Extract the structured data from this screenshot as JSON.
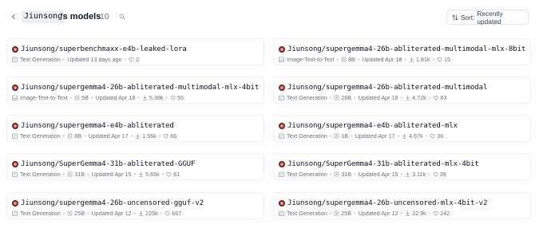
{
  "header": {
    "back_icon": "chevron-left-icon",
    "username": "Jiunsong",
    "title_suffix": "'s models",
    "count": "10",
    "search_icon": "search-icon",
    "sort_label": "Sort:",
    "sort_value": "Recently updated",
    "sort_icon": "sort-arrows-icon"
  },
  "models": [
    {
      "name": "Jiunsong/superbenchmaxx-e4b-leaked-lora",
      "task": "Text Generation",
      "task_icon": "text-generation-icon",
      "params": "",
      "updated": "Updated 13 days ago",
      "downloads": "",
      "likes": "2"
    },
    {
      "name": "Jiunsong/supergemma4-26b-abliterated-multimodal-mlx-8bit",
      "task": "Image-Text-to-Text",
      "task_icon": "image-text-to-text-icon",
      "params": "8B",
      "updated": "Updated Apr 18",
      "downloads": "1.81k",
      "likes": "15"
    },
    {
      "name": "Jiunsong/supergemma4-26b-abliterated-multimodal-mlx-4bit",
      "task": "Image-Text-to-Text",
      "task_icon": "image-text-to-text-icon",
      "params": "5B",
      "updated": "Updated Apr 18",
      "downloads": "5.38k",
      "likes": "55"
    },
    {
      "name": "Jiunsong/supergemma4-26b-abliterated-multimodal",
      "task": "Text Generation",
      "task_icon": "text-generation-icon",
      "params": "26B",
      "updated": "Updated Apr 18",
      "downloads": "4.72k",
      "likes": "83"
    },
    {
      "name": "Jiunsong/supergemma4-e4b-abliterated",
      "task": "Text Generation",
      "task_icon": "text-generation-icon",
      "params": "8B",
      "updated": "Updated Apr 17",
      "downloads": "1.56k",
      "likes": "66"
    },
    {
      "name": "Jiunsong/supergemma4-e4b-abliterated-mlx",
      "task": "Text Generation",
      "task_icon": "text-generation-icon",
      "params": "1B",
      "updated": "Updated Apr 17",
      "downloads": "4.67k",
      "likes": "36"
    },
    {
      "name": "Jiunsong/SuperGemma4-31b-abliterated-GGUF",
      "task": "Text Generation",
      "task_icon": "text-generation-icon",
      "params": "31B",
      "updated": "Updated Apr 15",
      "downloads": "5.65k",
      "likes": "61"
    },
    {
      "name": "Jiunsong/SuperGemma4-31b-abliterated-mlx-4bit",
      "task": "Text Generation",
      "task_icon": "text-generation-icon",
      "params": "31B",
      "updated": "Updated Apr 15",
      "downloads": "3.11k",
      "likes": "39"
    },
    {
      "name": "Jiunsong/supergemma4-26b-uncensored-gguf-v2",
      "task": "Text Generation",
      "task_icon": "text-generation-icon",
      "params": "25B",
      "updated": "Updated Apr 12",
      "downloads": "225k",
      "likes": "667"
    },
    {
      "name": "Jiunsong/supergemma4-26b-uncensored-mlx-4bit-v2",
      "task": "Text Generation",
      "task_icon": "text-generation-icon",
      "params": "25B",
      "updated": "Updated Apr 12",
      "downloads": "22.9k",
      "likes": "242"
    }
  ]
}
